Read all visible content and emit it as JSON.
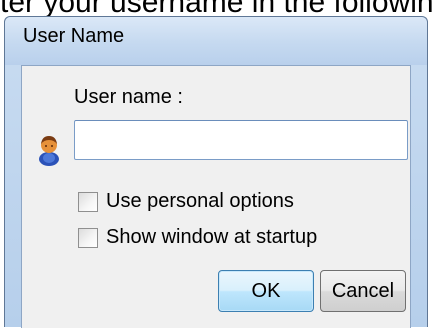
{
  "background_text": "ter your username in the following",
  "dialog": {
    "title": "User Name",
    "username_label": "User name :",
    "username_value": "",
    "options": [
      {
        "label": "Use personal options",
        "checked": false
      },
      {
        "label": "Show window at startup",
        "checked": false
      }
    ],
    "ok_label": "OK",
    "cancel_label": "Cancel"
  },
  "icons": {
    "user": "user-icon"
  },
  "colors": {
    "titlebar": "#c5d9f0",
    "client_bg": "#f0f0f0",
    "ok_border": "#3c7fb1"
  }
}
